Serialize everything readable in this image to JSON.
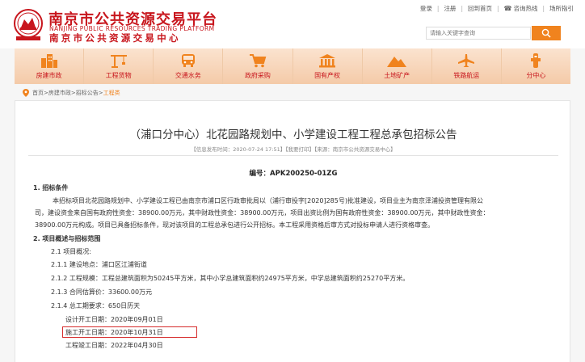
{
  "header": {
    "title_cn": "南京市公共资源交易平台",
    "title_en": "NANJING PUBLIC RESOURCES TRADING PLATFORM",
    "subtitle": "南京市公共资源交易中心",
    "links": [
      "登录",
      "注册",
      "回到首页",
      "咨询热线",
      "场所指引"
    ],
    "search_placeholder": "请输入关键字查询"
  },
  "nav": [
    {
      "label": "房建市政",
      "icon": "buildings-icon"
    },
    {
      "label": "工程货物",
      "icon": "crane-icon"
    },
    {
      "label": "交通水务",
      "icon": "bus-icon"
    },
    {
      "label": "政府采购",
      "icon": "cart-icon"
    },
    {
      "label": "国有产权",
      "icon": "bank-icon"
    },
    {
      "label": "土地矿产",
      "icon": "mountain-icon"
    },
    {
      "label": "铁路航运",
      "icon": "plane-icon"
    },
    {
      "label": "分中心",
      "icon": "branch-icon"
    }
  ],
  "breadcrumb": {
    "path": "首页>房建市政>招标公告>",
    "current": "工程类"
  },
  "article": {
    "title": "（浦口分中心）北花园路规划中、小学建设工程工程总承包招标公告",
    "meta": "【信息发布时间：2020-07-24 17:51】【我要打印】【来源：南京市公共资源交易中心】",
    "code": "编号：APK200250-01ZG",
    "lines": [
      "1. 招标条件",
      "本招标项目北花园路规划中、小学建设工程已由南京市浦口区行政审批局以（浦行审投字[2020]285号)批准建设，项目业主为南京泽浦投资管理有限公",
      "司，建设资金来自国有政府性资金：38900.00万元，其中财政性资金：38900.00万元，项目出资比例为国有政府性资金：38900.00万元，其中财政性资金：",
      "38900.00万元构成。项目已具备招标条件，现对该项目的工程总承包进行公开招标。本工程采用资格后审方式对投标申请人进行资格审查。",
      "2. 项目概述与招标范围",
      "2.1 项目概况:",
      "2.1.1 建设地点：浦口区江浦街道",
      "2.1.2 工程规模：工程总建筑面积为50245平方米，其中小学总建筑面积约24975平方米，中学总建筑面积约25270平方米。",
      "2.1.3 合同估算价：33600.00万元",
      "2.1.4 总工期要求：650日历天",
      "设计开工日期：2020年09月01日",
      "施工开工日期：2020年10月31日",
      "工程竣工日期：2022年04月30日"
    ]
  },
  "colors": {
    "brand_red": "#c8161d",
    "accent_orange": "#f0831e",
    "highlight_box": "#d62b2b"
  }
}
